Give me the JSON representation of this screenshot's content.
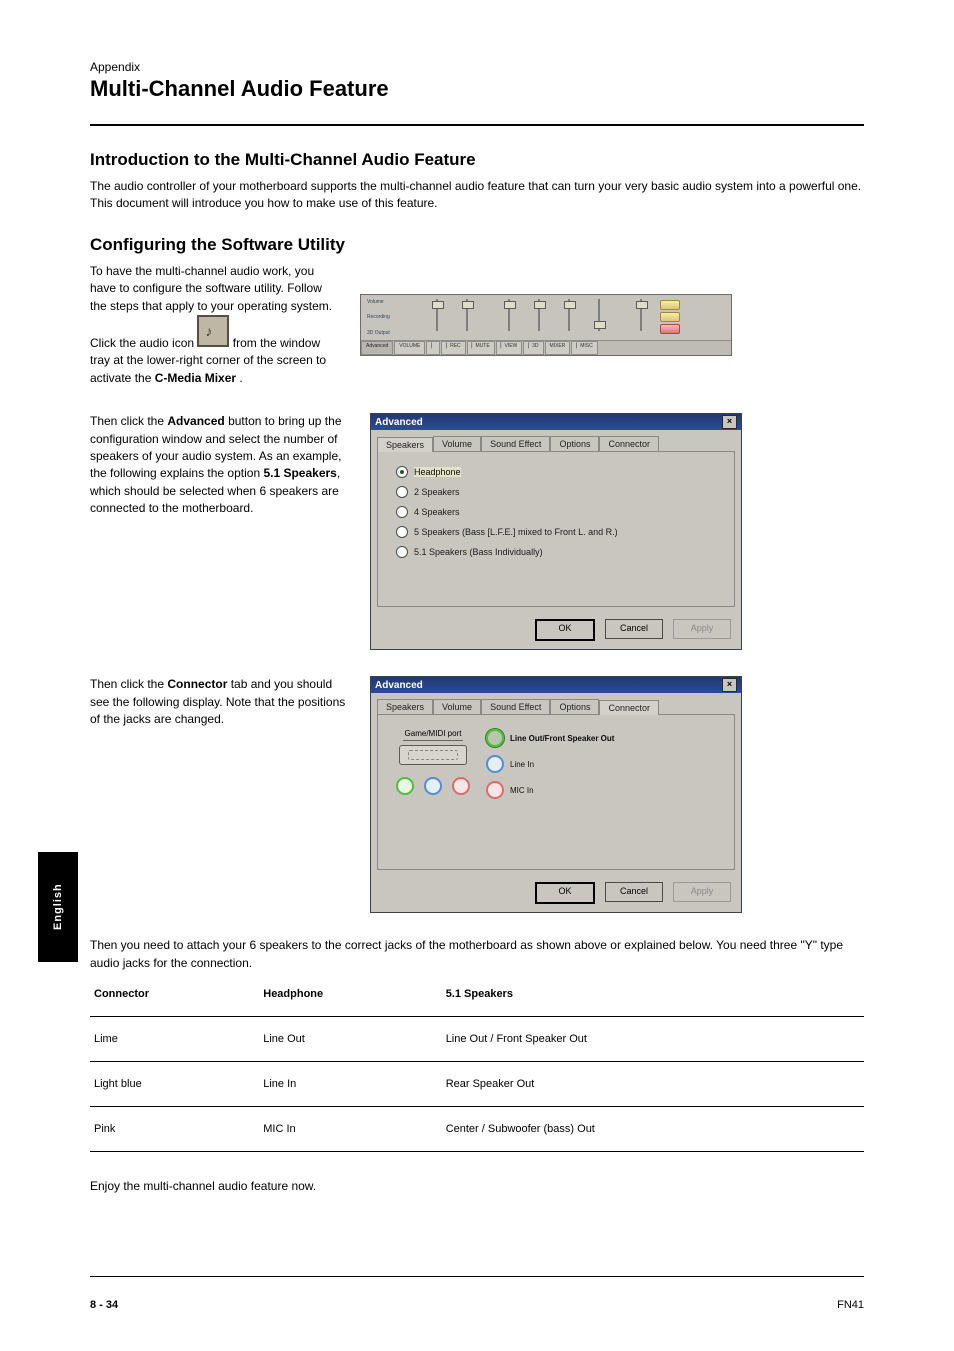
{
  "header": {
    "kicker": "Appendix",
    "title": "Multi-Channel Audio Feature"
  },
  "intro": {
    "heading": "Introduction to the Multi-Channel Audio Feature",
    "p1": "The audio controller of your motherboard supports the multi-channel audio feature that can turn your very basic audio system into a powerful one. This document will introduce you how to make use of this feature.",
    "configuring_heading": "Configuring the Software Utility",
    "p2_a": "To have the multi-channel audio work, you have to configure the software utility. Follow the steps that apply to your operating system. Click the audio icon ",
    "p2_b": " from the window tray at the lower-right corner of the screen to activate the ",
    "p2_c": "C-Media Mixer",
    "p2_d": "."
  },
  "mixer": {
    "left_labels": {
      "a": "Volume",
      "b": "Recording",
      "c": "3D Output"
    },
    "tabs": [
      "Advanced",
      "VOLUME",
      "▏",
      "▏REC",
      "▏MUTE",
      "▏VIEW",
      "▏3D",
      "MIXER",
      "▏MISC"
    ]
  },
  "step3": {
    "text_a": "Then click the ",
    "text_b": "Advanced",
    "text_c": " button to bring up the configuration window and select the number of speakers of your audio system. As an example, the following explains the option ",
    "text_d": "5.1 Speakers",
    "text_e": ", which should be selected when 6 speakers are connected to the motherboard."
  },
  "dialog1": {
    "title": "Advanced",
    "tabs": [
      "Speakers",
      "Volume",
      "Sound Effect",
      "Options",
      "Connector"
    ],
    "active_tab": 0,
    "radios": [
      {
        "label": "Headphone",
        "checked": true
      },
      {
        "label": "2 Speakers",
        "checked": false
      },
      {
        "label": "4 Speakers",
        "checked": false
      },
      {
        "label": "5 Speakers   (Bass [L.F.E.] mixed to Front L. and R.)",
        "checked": false
      },
      {
        "label": "5.1 Speakers   (Bass Individually)",
        "checked": false
      }
    ],
    "buttons": {
      "ok": "OK",
      "cancel": "Cancel",
      "apply": "Apply"
    }
  },
  "step4": {
    "text_a": "Then click the ",
    "text_b": "Connector",
    "text_c": " tab and you should see the following display. Note that the positions of the jacks are changed."
  },
  "dialog2": {
    "title": "Advanced",
    "tabs": [
      "Speakers",
      "Volume",
      "Sound Effect",
      "Options",
      "Connector"
    ],
    "active_tab": 4,
    "gameport_label": "Game/MIDI port",
    "connectors": [
      {
        "label": "Line Out/Front Speaker Out",
        "color": "lime",
        "selected": true
      },
      {
        "label": "Line In",
        "color": "blue",
        "selected": false
      },
      {
        "label": "MIC In",
        "color": "pink",
        "selected": false
      }
    ],
    "buttons": {
      "ok": "OK",
      "cancel": "Cancel",
      "apply": "Apply"
    }
  },
  "table_intro": "Then you need to attach your 6 speakers to the correct jacks of the motherboard as shown above or explained below. You need three \"Y\" type audio jacks for the connection.",
  "table": {
    "headers": [
      "Connector",
      "Headphone",
      "5.1 Speakers"
    ],
    "rows": [
      [
        "Lime",
        "Line Out",
        "Line Out / Front Speaker Out"
      ],
      [
        "Light blue",
        "Line In",
        "Rear Speaker Out"
      ],
      [
        "Pink",
        "MIC In",
        "Center / Subwoofer (bass) Out"
      ]
    ]
  },
  "closing": "Enjoy the multi-channel audio feature now.",
  "side_tab": "English",
  "footer": {
    "page": "8 - 34",
    "model": "FN41"
  }
}
